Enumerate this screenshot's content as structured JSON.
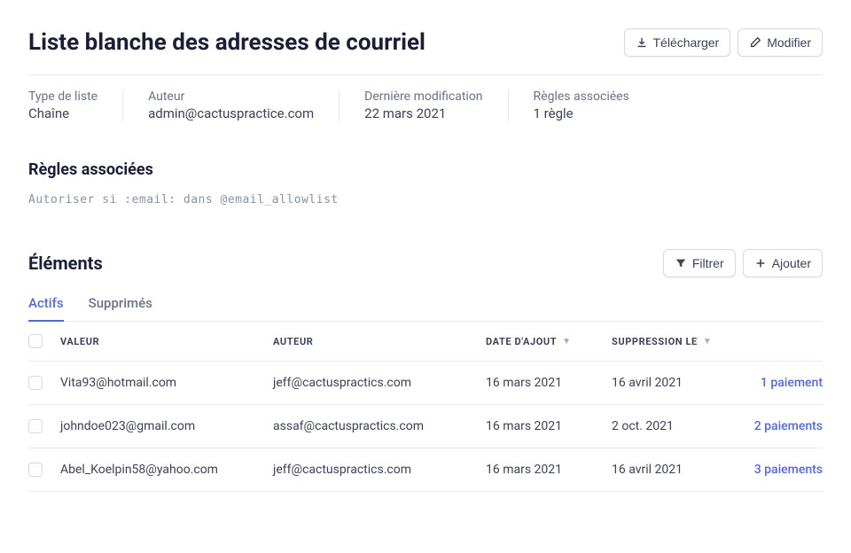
{
  "header": {
    "title": "Liste blanche des adresses de courriel",
    "download_label": "Télécharger",
    "edit_label": "Modifier"
  },
  "meta": {
    "type_label": "Type de liste",
    "type_value": "Chaîne",
    "author_label": "Auteur",
    "author_value": "admin@cactuspractice.com",
    "modified_label": "Dernière modification",
    "modified_value": "22 mars 2021",
    "rules_label": "Règles associées",
    "rules_value": "1 règle"
  },
  "rules_section": {
    "title": "Règles associées",
    "code_prefix": "Autoriser si",
    "code_rest": " :email: dans @email_allowlist"
  },
  "items_section": {
    "title": "Éléments",
    "filter_label": "Filtrer",
    "add_label": "Ajouter",
    "tab_active": "Actifs",
    "tab_removed": "Supprimés"
  },
  "table": {
    "headers": {
      "value": "VALEUR",
      "author": "AUTEUR",
      "added": "DATE D'AJOUT",
      "removed": "SUPPRESSION LE"
    },
    "rows": [
      {
        "value": "Vita93@hotmail.com",
        "author": "jeff@cactuspractics.com",
        "added": "16 mars 2021",
        "removed": "16 avril 2021",
        "payments": "1 paiement"
      },
      {
        "value": "johndoe023@gmail.com",
        "author": "assaf@cactuspractics.com",
        "added": "16 mars 2021",
        "removed": "2 oct. 2021",
        "payments": "2 paiements"
      },
      {
        "value": "Abel_Koelpin58@yahoo.com",
        "author": "jeff@cactuspractics.com",
        "added": "16 mars 2021",
        "removed": "16 avril 2021",
        "payments": "3 paiements"
      }
    ]
  }
}
